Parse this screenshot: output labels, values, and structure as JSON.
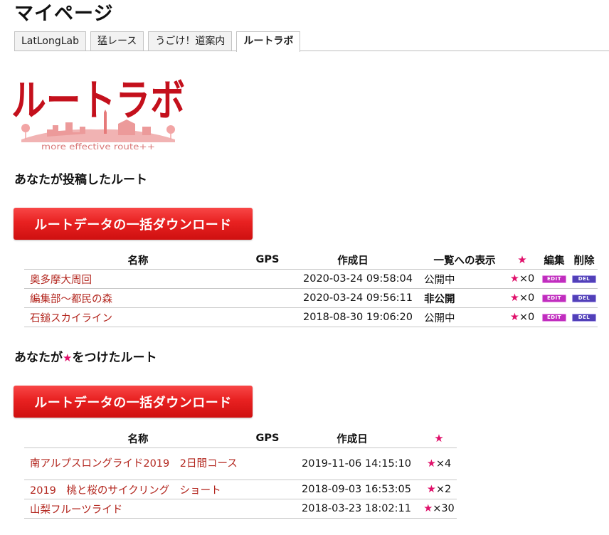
{
  "page": {
    "title": "マイページ"
  },
  "tabs": [
    {
      "label": "LatLongLab",
      "active": false
    },
    {
      "label": "猛レース",
      "active": false
    },
    {
      "label": "うごけ！道案内",
      "active": false
    },
    {
      "label": "ルートラボ",
      "active": true
    }
  ],
  "logo": {
    "title": "ルートラボ",
    "tagline": "more effective route++"
  },
  "posted": {
    "heading": "あなたが投稿したルート",
    "download_label": "ルートデータの一括ダウンロード",
    "columns": {
      "name": "名称",
      "gps": "GPS",
      "created": "作成日",
      "visibility": "一覧への表示",
      "star": "★",
      "edit": "編集",
      "delete": "削除"
    },
    "rows": [
      {
        "name": "奥多摩大周回",
        "gps": "",
        "created": "2020-03-24 09:58:04",
        "visibility": "公開中",
        "private": false,
        "stars": "×0"
      },
      {
        "name": "編集部～都民の森",
        "gps": "",
        "created": "2020-03-24 09:56:11",
        "visibility": "非公開",
        "private": true,
        "stars": "×0"
      },
      {
        "name": "石鎚スカイライン",
        "gps": "",
        "created": "2018-08-30 19:06:20",
        "visibility": "公開中",
        "private": false,
        "stars": "×0"
      }
    ],
    "edit_label": "EDIT",
    "delete_label": "DEL"
  },
  "starred": {
    "heading_before": "あなたが",
    "heading_star": "★",
    "heading_after": "をつけたルート",
    "download_label": "ルートデータの一括ダウンロード",
    "columns": {
      "name": "名称",
      "gps": "GPS",
      "created": "作成日",
      "star": "★"
    },
    "rows": [
      {
        "name": "南アルプスロングライド2019　2日間コース",
        "gps": "",
        "created": "2019-11-06 14:15:10",
        "stars": "×4"
      },
      {
        "name": "2019　桃と桜のサイクリング　ショート",
        "gps": "",
        "created": "2018-09-03 16:53:05",
        "stars": "×2"
      },
      {
        "name": "山梨フルーツライド",
        "gps": "",
        "created": "2018-03-23 18:02:11",
        "stars": "×30"
      }
    ]
  },
  "colors": {
    "link": "#b3261e",
    "star": "#e0106a",
    "button": "#e82121",
    "edit": "#c02dbe",
    "delete": "#5140b8"
  }
}
